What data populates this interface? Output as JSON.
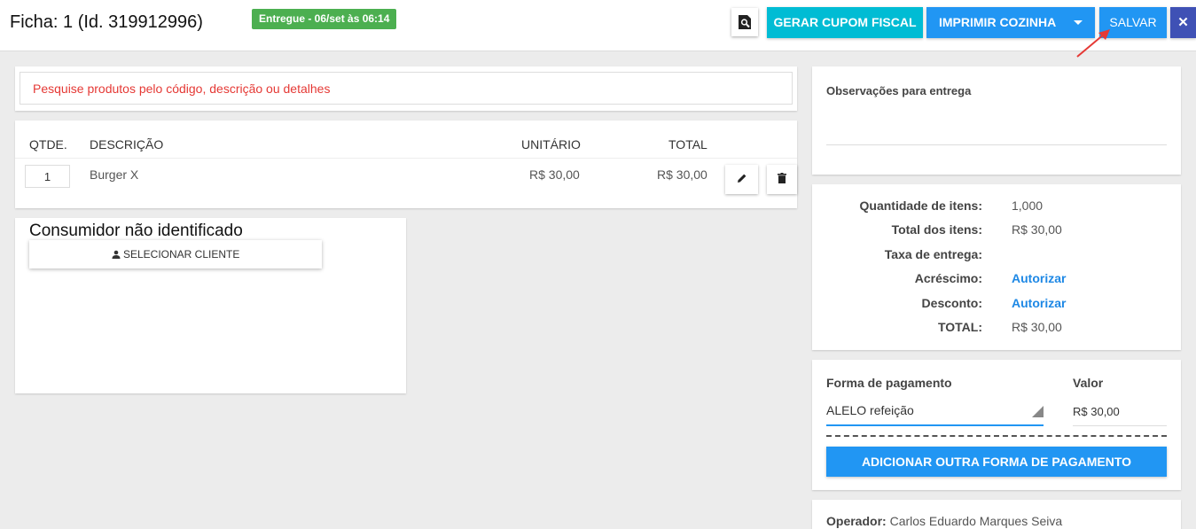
{
  "header": {
    "title": "Ficha: 1 (Id. 319912996)",
    "status_badge": "Entregue - 06/set às 06:14",
    "gerar_cupom": "GERAR CUPOM FISCAL",
    "imprimir_cozinha": "IMPRIMIR COZINHA",
    "salvar": "SALVAR",
    "close": "✕"
  },
  "search": {
    "placeholder": "Pesquise produtos pelo código, descrição ou detalhes"
  },
  "table": {
    "columns": {
      "qty": "QTDE.",
      "desc": "DESCRIÇÃO",
      "unit": "UNITÁRIO",
      "total": "TOTAL"
    },
    "rows": [
      {
        "qty": "1",
        "desc": "Burger X",
        "unit": "R$ 30,00",
        "total": "R$ 30,00"
      }
    ]
  },
  "customer": {
    "title": "Consumidor não identificado",
    "select_button": "SELECIONAR CLIENTE"
  },
  "notes": {
    "label": "Observações para entrega"
  },
  "summary": {
    "qty_label": "Quantidade de itens:",
    "qty_value": "1,000",
    "total_items_label": "Total dos itens:",
    "total_items_value": "R$ 30,00",
    "delivery_label": "Taxa de entrega:",
    "surcharge_label": "Acréscimo:",
    "surcharge_link": "Autorizar",
    "discount_label": "Desconto:",
    "discount_link": "Autorizar",
    "total_label": "TOTAL:",
    "total_value": "R$ 30,00"
  },
  "payment": {
    "method_label": "Forma de pagamento",
    "value_label": "Valor",
    "method": "ALELO refeição",
    "value": "R$ 30,00",
    "add_button": "ADICIONAR OUTRA FORMA DE PAGAMENTO"
  },
  "operator": {
    "label": "Operador:",
    "name": "Carlos Eduardo Marques Seiva"
  },
  "colors": {
    "accent": "#2196f3",
    "teal": "#00bcd4",
    "success": "#4caf50",
    "indigo": "#3f51b5",
    "error": "#e53935",
    "annotation": "#e53935"
  },
  "icons": [
    "search-doc-icon",
    "caret-down-icon",
    "close-icon",
    "pencil-icon",
    "trash-icon",
    "person-icon",
    "dropdown-triangle-icon",
    "annotation-arrow"
  ]
}
